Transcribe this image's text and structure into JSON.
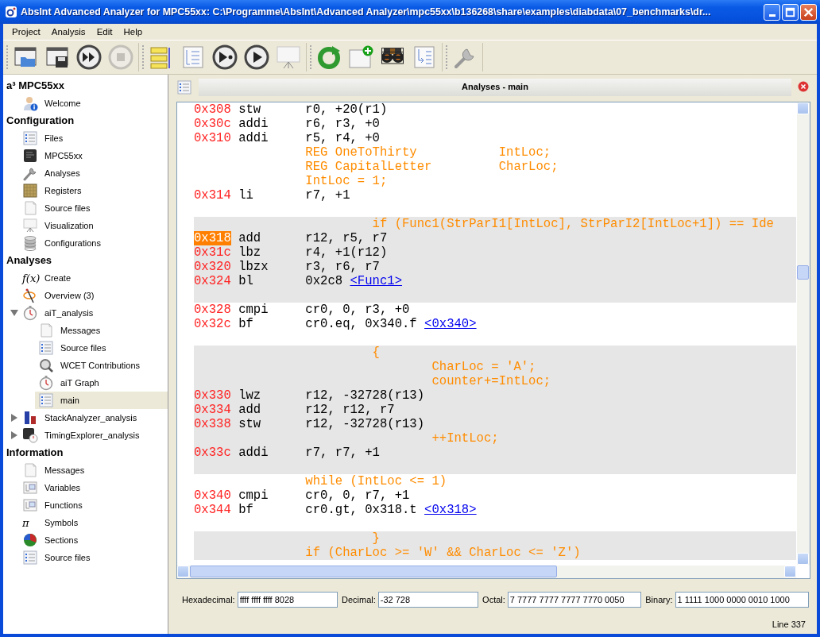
{
  "window": {
    "title": "AbsInt Advanced Analyzer for MPC55xx: C:\\Programme\\AbsInt\\Advanced Analyzer\\mpc55xx\\b136268\\share\\examples\\diabdata\\07_benchmarks\\dr..."
  },
  "menu": [
    "Project",
    "Analysis",
    "Edit",
    "Help"
  ],
  "toolbar": [
    [
      {
        "disabled": false
      },
      {
        "disabled": false
      },
      {
        "disabled": false
      },
      {
        "disabled": true
      }
    ],
    [
      {
        "disabled": false
      },
      {
        "disabled": false
      },
      {
        "disabled": false
      },
      {
        "disabled": false
      },
      {
        "disabled": false
      }
    ],
    [
      {
        "disabled": false
      },
      {
        "disabled": false
      },
      {
        "disabled": false
      },
      {
        "disabled": false
      }
    ],
    [
      {
        "disabled": false
      }
    ]
  ],
  "sidebar": {
    "sections": [
      {
        "title": "a³ MPC55xx",
        "items": [
          {
            "label": "Welcome",
            "selected": false
          }
        ]
      },
      {
        "title": "Configuration",
        "items": [
          {
            "label": "Files",
            "selected": false
          },
          {
            "label": "MPC55xx",
            "selected": false
          },
          {
            "label": "Analyses",
            "selected": false
          },
          {
            "label": "Registers",
            "selected": false
          },
          {
            "label": "Source files",
            "selected": false
          },
          {
            "label": "Visualization",
            "selected": false
          },
          {
            "label": "Configurations",
            "selected": false
          }
        ]
      },
      {
        "title": "Analyses",
        "items": [
          {
            "label": "Create",
            "selected": false,
            "icon_text": "f(x)"
          },
          {
            "label": "Overview (3)",
            "selected": false
          },
          {
            "label": "aiT_analysis",
            "selected": false,
            "expanded": true,
            "children": [
              {
                "label": "Messages",
                "selected": false
              },
              {
                "label": "Source files",
                "selected": false
              },
              {
                "label": "WCET Contributions",
                "selected": false
              },
              {
                "label": "aiT Graph",
                "selected": false
              },
              {
                "label": "main",
                "selected": true
              }
            ]
          },
          {
            "label": "StackAnalyzer_analysis",
            "selected": false,
            "expanded": false
          },
          {
            "label": "TimingExplorer_analysis",
            "selected": false,
            "expanded": false
          }
        ]
      },
      {
        "title": "Information",
        "items": [
          {
            "label": "Messages",
            "selected": false
          },
          {
            "label": "Variables",
            "selected": false
          },
          {
            "label": "Functions",
            "selected": false
          },
          {
            "label": "Symbols",
            "selected": false,
            "icon_text": "π"
          },
          {
            "label": "Sections",
            "selected": false
          },
          {
            "label": "Source files",
            "selected": false
          }
        ]
      }
    ]
  },
  "panel": {
    "title": "Analyses - main"
  },
  "code": {
    "blocks": [
      {
        "shaded": false,
        "lines": [
          {
            "kind": "instr",
            "address": "0x308",
            "mnemonic": "stw",
            "operands": "r0, +20(r1)",
            "selected": false
          },
          {
            "kind": "instr",
            "address": "0x30c",
            "mnemonic": "addi",
            "operands": "r6, r3, +0",
            "selected": false
          },
          {
            "kind": "instr",
            "address": "0x310",
            "mnemonic": "addi",
            "operands": "r5, r4, +0",
            "selected": false
          },
          {
            "kind": "source",
            "text": "REG OneToThirty           IntLoc;"
          },
          {
            "kind": "source",
            "text": "REG CapitalLetter         CharLoc;"
          },
          {
            "kind": "source",
            "text": "IntLoc = 1;"
          },
          {
            "kind": "instr",
            "address": "0x314",
            "mnemonic": "li",
            "operands": "r7, +1",
            "selected": false
          },
          {
            "kind": "blank"
          }
        ]
      },
      {
        "shaded": true,
        "lines": [
          {
            "kind": "source",
            "text": "         if (Func1(StrParI1[IntLoc], StrParI2[IntLoc+1]) == Ide"
          },
          {
            "kind": "instr",
            "address": "0x318",
            "mnemonic": "add",
            "operands": "r12, r5, r7",
            "selected": true
          },
          {
            "kind": "instr",
            "address": "0x31c",
            "mnemonic": "lbz",
            "operands": "r4, +1(r12)",
            "selected": false
          },
          {
            "kind": "instr",
            "address": "0x320",
            "mnemonic": "lbzx",
            "operands": "r3, r6, r7",
            "selected": false
          },
          {
            "kind": "instr",
            "address": "0x324",
            "mnemonic": "bl",
            "operands": "0x2c8",
            "link": "<Func1>",
            "selected": false
          },
          {
            "kind": "blank"
          }
        ]
      },
      {
        "shaded": false,
        "lines": [
          {
            "kind": "instr",
            "address": "0x328",
            "mnemonic": "cmpi",
            "operands": "cr0, 0, r3, +0",
            "selected": false
          },
          {
            "kind": "instr",
            "address": "0x32c",
            "mnemonic": "bf",
            "operands": "cr0.eq, 0x340.f",
            "link": "<0x340>",
            "selected": false
          },
          {
            "kind": "blank"
          }
        ]
      },
      {
        "shaded": true,
        "lines": [
          {
            "kind": "source",
            "text": "         {"
          },
          {
            "kind": "source",
            "text": "                 CharLoc = 'A';"
          },
          {
            "kind": "source",
            "text": "                 counter+=IntLoc;"
          },
          {
            "kind": "instr",
            "address": "0x330",
            "mnemonic": "lwz",
            "operands": "r12, -32728(r13)",
            "selected": false
          },
          {
            "kind": "instr",
            "address": "0x334",
            "mnemonic": "add",
            "operands": "r12, r12, r7",
            "selected": false
          },
          {
            "kind": "instr",
            "address": "0x338",
            "mnemonic": "stw",
            "operands": "r12, -32728(r13)",
            "selected": false
          },
          {
            "kind": "source",
            "text": "                 ++IntLoc;"
          },
          {
            "kind": "instr",
            "address": "0x33c",
            "mnemonic": "addi",
            "operands": "r7, r7, +1",
            "selected": false
          },
          {
            "kind": "blank"
          }
        ]
      },
      {
        "shaded": false,
        "lines": [
          {
            "kind": "source",
            "text": "while (IntLoc <= 1)"
          },
          {
            "kind": "instr",
            "address": "0x340",
            "mnemonic": "cmpi",
            "operands": "cr0, 0, r7, +1",
            "selected": false
          },
          {
            "kind": "instr",
            "address": "0x344",
            "mnemonic": "bf",
            "operands": "cr0.gt, 0x318.t",
            "link": "<0x318>",
            "selected": false
          },
          {
            "kind": "blank"
          }
        ]
      },
      {
        "shaded": true,
        "lines": [
          {
            "kind": "source",
            "text": "         }"
          },
          {
            "kind": "source",
            "text": "if (CharLoc >= 'W' && CharLoc <= 'Z')"
          }
        ]
      }
    ]
  },
  "converter": [
    {
      "label": "Hexadecimal:",
      "value": "ffff ffff ffff 8028"
    },
    {
      "label": "Decimal:",
      "value": "-32 728"
    },
    {
      "label": "Octal:",
      "value": "7 7777 7777 7777 7770 0050"
    },
    {
      "label": "Binary:",
      "value": "1 1111 1000 0000 0010 1000"
    }
  ],
  "status_bar": {
    "text": "Line 337"
  }
}
